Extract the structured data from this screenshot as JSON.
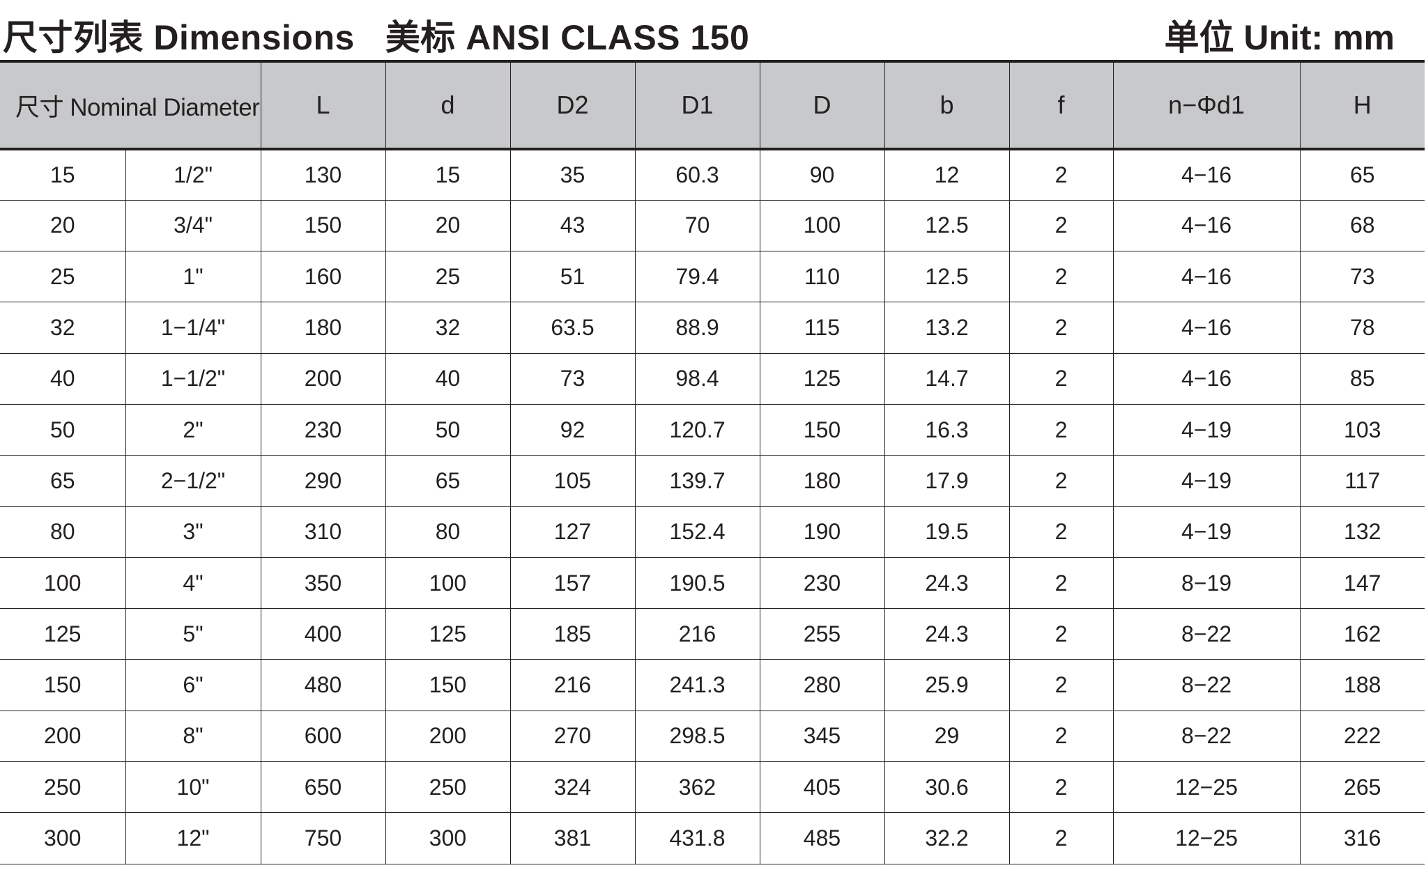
{
  "title": {
    "left_cn": "尺寸列表",
    "left_en": "Dimensions",
    "standard_cn": "美标",
    "standard_en": "ANSI CLASS 150",
    "unit": "单位 Unit: mm"
  },
  "table": {
    "headers": [
      "尺寸 Nominal Diameter",
      "L",
      "d",
      "D2",
      "D1",
      "D",
      "b",
      "f",
      "n−Φd1",
      "H"
    ],
    "rows": [
      [
        "15",
        "1/2\"",
        "130",
        "15",
        "35",
        "60.3",
        "90",
        "12",
        "2",
        "4−16",
        "65"
      ],
      [
        "20",
        "3/4\"",
        "150",
        "20",
        "43",
        "70",
        "100",
        "12.5",
        "2",
        "4−16",
        "68"
      ],
      [
        "25",
        "1\"",
        "160",
        "25",
        "51",
        "79.4",
        "110",
        "12.5",
        "2",
        "4−16",
        "73"
      ],
      [
        "32",
        "1−1/4\"",
        "180",
        "32",
        "63.5",
        "88.9",
        "115",
        "13.2",
        "2",
        "4−16",
        "78"
      ],
      [
        "40",
        "1−1/2\"",
        "200",
        "40",
        "73",
        "98.4",
        "125",
        "14.7",
        "2",
        "4−16",
        "85"
      ],
      [
        "50",
        "2\"",
        "230",
        "50",
        "92",
        "120.7",
        "150",
        "16.3",
        "2",
        "4−19",
        "103"
      ],
      [
        "65",
        "2−1/2\"",
        "290",
        "65",
        "105",
        "139.7",
        "180",
        "17.9",
        "2",
        "4−19",
        "117"
      ],
      [
        "80",
        "3\"",
        "310",
        "80",
        "127",
        "152.4",
        "190",
        "19.5",
        "2",
        "4−19",
        "132"
      ],
      [
        "100",
        "4\"",
        "350",
        "100",
        "157",
        "190.5",
        "230",
        "24.3",
        "2",
        "8−19",
        "147"
      ],
      [
        "125",
        "5\"",
        "400",
        "125",
        "185",
        "216",
        "255",
        "24.3",
        "2",
        "8−22",
        "162"
      ],
      [
        "150",
        "6\"",
        "480",
        "150",
        "216",
        "241.3",
        "280",
        "25.9",
        "2",
        "8−22",
        "188"
      ],
      [
        "200",
        "8\"",
        "600",
        "200",
        "270",
        "298.5",
        "345",
        "29",
        "2",
        "8−22",
        "222"
      ],
      [
        "250",
        "10\"",
        "650",
        "250",
        "324",
        "362",
        "405",
        "30.6",
        "2",
        "12−25",
        "265"
      ],
      [
        "300",
        "12\"",
        "750",
        "300",
        "381",
        "431.8",
        "485",
        "32.2",
        "2",
        "12−25",
        "316"
      ]
    ]
  }
}
